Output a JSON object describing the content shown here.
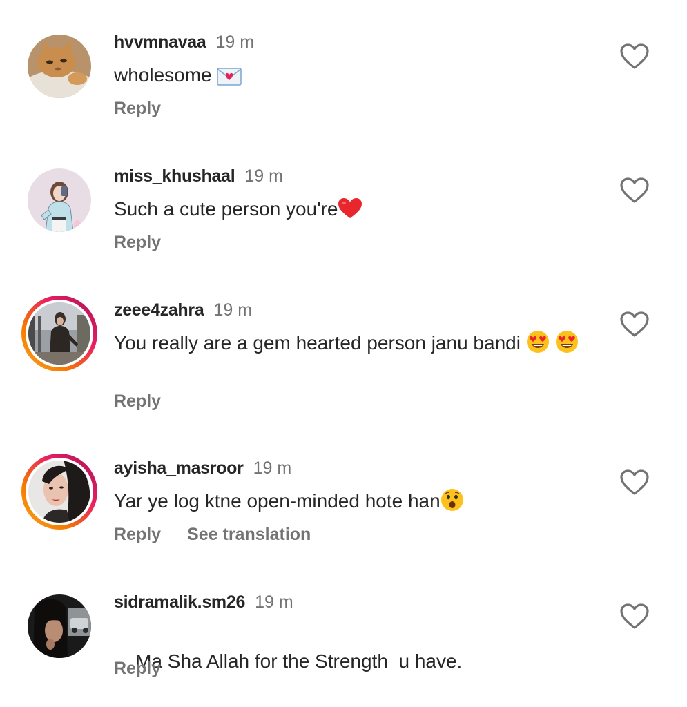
{
  "comments": [
    {
      "username": "hvvmnavaa",
      "time": "19 m",
      "text": "wholesome",
      "emoji": "love-letter",
      "reply": "Reply",
      "avatar": "cat-photo",
      "story_ring": false
    },
    {
      "username": "miss_khushaal",
      "time": "19 m",
      "text": "Such a cute person you're",
      "emoji": "red-heart",
      "reply": "Reply",
      "avatar": "illustrated-girl",
      "story_ring": false
    },
    {
      "username": "zeee4zahra",
      "time": "19 m",
      "text": "You really are a gem hearted person janu bandi",
      "emoji": "heart-eyes",
      "reply": "Reply",
      "avatar": "person-standing-photo",
      "story_ring": true
    },
    {
      "username": "ayisha_masroor",
      "time": "19 m",
      "text": "Yar ye log ktne open-minded hote han",
      "emoji": "astonished-face",
      "reply": "Reply",
      "see_translation": "See translation",
      "avatar": "woman-portrait",
      "story_ring": true
    },
    {
      "username": "sidramalik.sm26",
      "time": "19 m",
      "text": "Ma Sha Allah for the Strength  u have.",
      "reply": "Reply",
      "avatar": "woman-dark-photo",
      "story_ring": false
    }
  ],
  "colors": {
    "primary_text": "#262626",
    "secondary_text": "#737373",
    "story_ring_start": "#f9a825",
    "story_ring_end": "#9c27b0"
  },
  "icons": {
    "like": "heart-outline-icon"
  }
}
